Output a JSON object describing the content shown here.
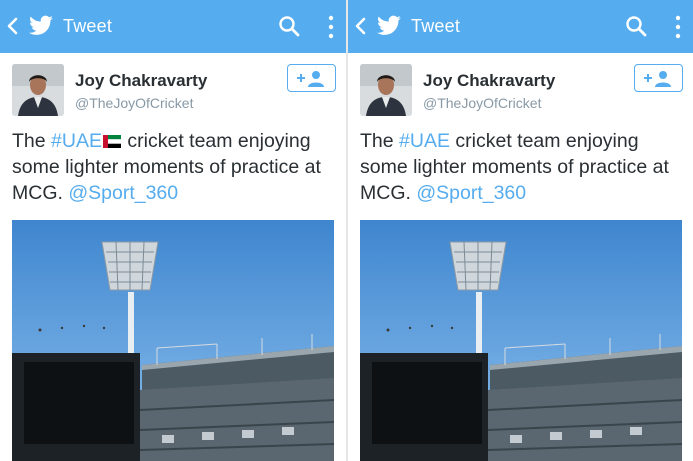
{
  "colors": {
    "accent": "#55acee",
    "text": "#292f33",
    "secondary_text": "#8899a6"
  },
  "header": {
    "title": "Tweet",
    "icons": [
      "back-arrow-icon",
      "twitter-bird-icon",
      "search-icon",
      "overflow-menu-icon"
    ]
  },
  "tweet": {
    "author_name": "Joy Chakravarty",
    "author_handle": "@TheJoyOfCricket",
    "follow_icon": "follow-person-icon",
    "text_parts": {
      "lead": "The ",
      "hashtag": "#UAE",
      "after_hashtag_left": " cricket team enjoying some lighter moments of practice at MCG. ",
      "after_hashtag_right": " cricket team enjoying some lighter moments of practice at MCG. ",
      "mention": "@Sport_360"
    },
    "flag_icon": "uae-flag-icon",
    "photo": "cricket-stadium-floodlight-photo"
  }
}
